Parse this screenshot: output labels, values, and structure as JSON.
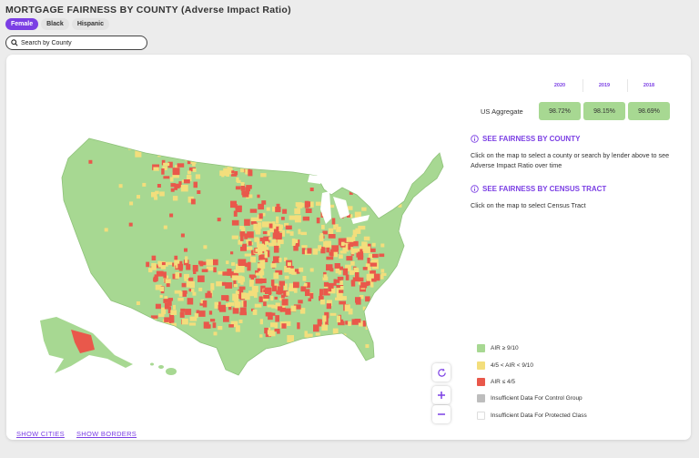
{
  "header": {
    "title": "MORTGAGE FAIRNESS BY COUNTY (Adverse Impact Ratio)"
  },
  "tabs": [
    {
      "label": "Female",
      "active": true
    },
    {
      "label": "Black",
      "active": false
    },
    {
      "label": "Hispanic",
      "active": false
    }
  ],
  "search": {
    "placeholder": "Search by County",
    "icon": "search-icon"
  },
  "aggregate": {
    "label": "US Aggregate",
    "years": [
      "2020",
      "2019",
      "2018"
    ],
    "values": [
      "98.72%",
      "98.15%",
      "98.69%"
    ]
  },
  "info": {
    "county_heading": "SEE FAIRNESS BY COUNTY",
    "county_text": "Click on the map to select a county or search by lender above to see Adverse Impact Ratio over time",
    "tract_heading": "SEE FAIRNESS BY CENSUS TRACT",
    "tract_text": "Click on the map to select Census Tract"
  },
  "controls": {
    "reset_icon": "reset-icon",
    "zoom_in_icon": "plus-icon",
    "zoom_out_icon": "minus-icon"
  },
  "legend": [
    {
      "label": "AIR ≥ 9/10",
      "color": "#a7d892"
    },
    {
      "label": "4/5 < AIR < 9/10",
      "color": "#f3de7c"
    },
    {
      "label": "AIR ≤ 4/5",
      "color": "#e9584b"
    },
    {
      "label": "Insufficient Data For Control Group",
      "color": "#bdbdbd"
    },
    {
      "label": "Insufficient Data For Protected Class",
      "color": "#ffffff"
    }
  ],
  "footer": {
    "show_cities": "SHOW CITIES",
    "show_borders": "SHOW BORDERS"
  },
  "colors": {
    "accent": "#7b3fe4",
    "green": "#a7d892",
    "yellow": "#f3de7c",
    "red": "#e9584b"
  }
}
